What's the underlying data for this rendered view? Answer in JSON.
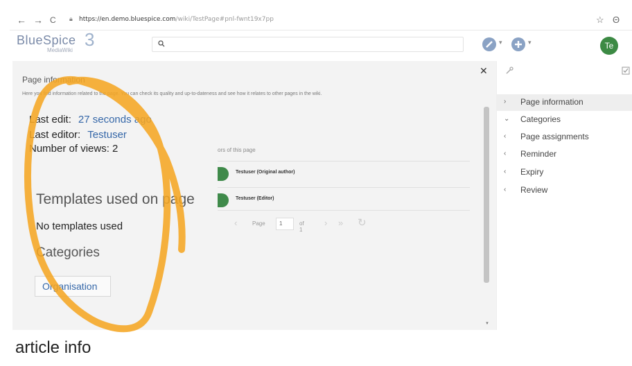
{
  "browser": {
    "back_icon": "←",
    "forward_icon": "→",
    "reload_icon": "C",
    "url_host": "https://en.demo.bluespice.com",
    "url_path": "/wiki/TestPage#pnl-fwnt19x7pp",
    "star_icon": "☆",
    "account_icon": "Θ"
  },
  "header": {
    "logo_text": "BlueSpice",
    "logo_number": "3",
    "logo_sub": "MediaWiki",
    "avatar_initials": "Te"
  },
  "panel": {
    "title": "Page information",
    "description": "Here you find information related to the page. You can check its quality and up-to-dateness and see how it relates to other pages in the wiki.",
    "close_icon": "✕",
    "last_edit_label": "Last edit:",
    "last_edit_value": "27 seconds ago",
    "last_editor_label": "Last editor:",
    "last_editor_value": "Testuser",
    "views_label": "Number of views: 2",
    "authors_label": "ors of this page",
    "authors": [
      {
        "name": "Testuser (Original author)"
      },
      {
        "name": "Testuser (Editor)"
      }
    ],
    "pager_label": "Page",
    "pager_value": "1",
    "pager_total": "of 1",
    "templates_heading": "Templates used on page",
    "templates_value": "No templates used",
    "categories_heading": "Categories",
    "category_tag": "Organisation"
  },
  "sidebar": {
    "items": [
      {
        "label": "Page information",
        "chevron": "›",
        "active": true
      },
      {
        "label": "Categories",
        "chevron": "⌄",
        "active": false
      },
      {
        "label": "Page assignments",
        "chevron": "‹",
        "active": false
      },
      {
        "label": "Reminder",
        "chevron": "‹",
        "active": false
      },
      {
        "label": "Expiry",
        "chevron": "‹",
        "active": false
      },
      {
        "label": "Review",
        "chevron": "‹",
        "active": false
      }
    ]
  },
  "caption": "article info",
  "colors": {
    "annotation": "#f5a623",
    "link": "#3567a8",
    "avatar": "#3c8a44"
  }
}
